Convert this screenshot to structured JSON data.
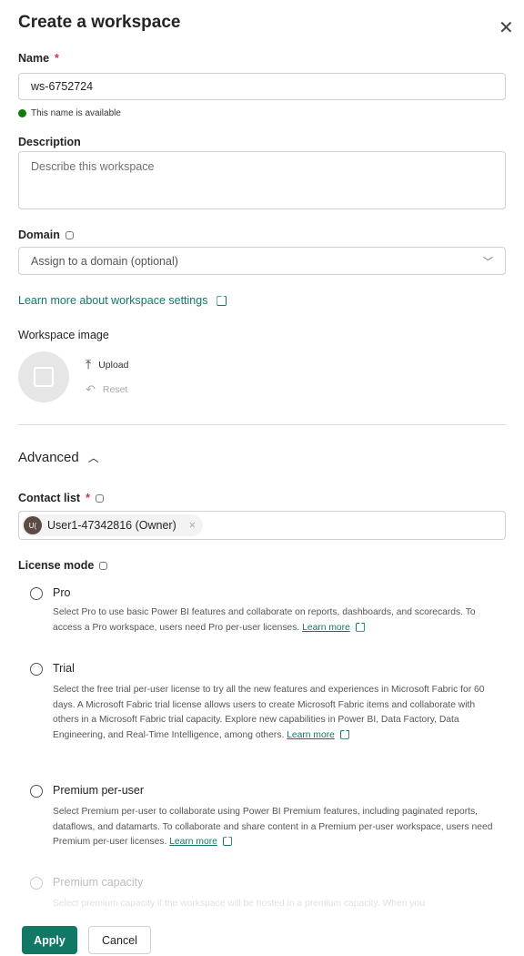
{
  "header": {
    "title": "Create a workspace",
    "close_icon": "close-icon"
  },
  "name": {
    "label": "Name",
    "required_mark": "*",
    "value": "ws-6752724",
    "status": "This name is available"
  },
  "description": {
    "label": "Description",
    "placeholder": "Describe this workspace"
  },
  "domain": {
    "label": "Domain",
    "placeholder": "Assign to a domain (optional)"
  },
  "learn_more_link": "Learn more about workspace settings",
  "workspace_image": {
    "label": "Workspace image",
    "upload": "Upload",
    "reset": "Reset"
  },
  "advanced": {
    "label": "Advanced",
    "expanded": true
  },
  "contact_list": {
    "label": "Contact list",
    "required_mark": "*",
    "user_initials": "U(",
    "user": "User1-47342816 (Owner)",
    "remove": "×"
  },
  "license_mode": {
    "label": "License mode",
    "options": [
      {
        "label": "Pro",
        "desc": "Select Pro to use basic Power BI features and collaborate on reports, dashboards, and scorecards. To access a Pro workspace, users need Pro per-user licenses.",
        "link": "Learn more",
        "selected": false,
        "disabled": false
      },
      {
        "label": "Trial",
        "desc": "Select the free trial per-user license to try all the new features and experiences in Microsoft Fabric for 60 days. A Microsoft Fabric trial license allows users to create Microsoft Fabric items and collaborate with others in a Microsoft Fabric trial capacity. Explore new capabilities in Power BI, Data Factory, Data Engineering, and Real-Time Intelligence, among others.",
        "link": "Learn more",
        "selected": false,
        "disabled": false
      },
      {
        "label": "Premium per-user",
        "desc": "Select Premium per-user to collaborate using Power BI Premium features, including paginated reports, dataflows, and datamarts. To collaborate and share content in a Premium per-user workspace, users need Premium per-user licenses.",
        "link": "Learn more",
        "selected": false,
        "disabled": false
      },
      {
        "label": "Premium capacity",
        "desc": "Select premium capacity if the workspace will be hosted in a premium capacity. When you",
        "selected": false,
        "disabled": true
      }
    ]
  },
  "footer": {
    "apply": "Apply",
    "cancel": "Cancel"
  },
  "colors": {
    "accent": "#117865",
    "required": "#c4314b",
    "success": "#107c10"
  }
}
